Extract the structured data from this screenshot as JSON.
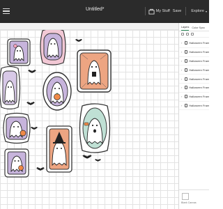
{
  "header": {
    "title": "Untitled*",
    "my_stuff": "My Stuff",
    "save": "Save",
    "explore": "Explore"
  },
  "panel": {
    "tabs": [
      {
        "label": "Layers",
        "active": true
      },
      {
        "label": "Color Sync",
        "active": false
      }
    ],
    "layers": [
      {
        "label": "Halloween Frames"
      },
      {
        "label": "Halloween Frames"
      },
      {
        "label": "Halloween Frames"
      },
      {
        "label": "Halloween Frames"
      },
      {
        "label": "Halloween Frames"
      },
      {
        "label": "Halloween Frames"
      },
      {
        "label": "Halloween Frames"
      },
      {
        "label": "Halloween Frames"
      }
    ],
    "blank_canvas": "Blank Canvas"
  },
  "colors": {
    "topbar": "#2b2b2b",
    "accent": "#2a8c5a",
    "lavender": "#c7b4dc",
    "peach": "#eda582",
    "mint": "#bfe0d4",
    "pink": "#f2c8d5"
  }
}
